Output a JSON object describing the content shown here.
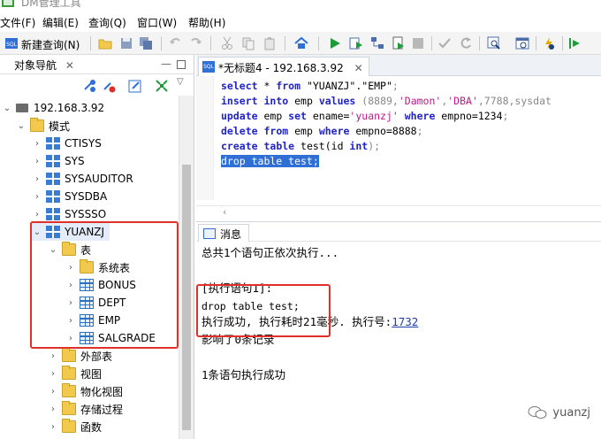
{
  "app": {
    "title": "DM管理工具"
  },
  "menu": [
    {
      "label": "文件(F)"
    },
    {
      "label": "编辑(E)"
    },
    {
      "label": "查询(Q)"
    },
    {
      "label": "窗口(W)"
    },
    {
      "label": "帮助(H)"
    }
  ],
  "toolbar": {
    "new_query_label": "新建查询(N)"
  },
  "navigator": {
    "tab_label": "对象导航",
    "server": "192.168.3.92",
    "schemas_label": "模式",
    "schemas": [
      "CTISYS",
      "SYS",
      "SYSAUDITOR",
      "SYSDBA",
      "SYSSSO",
      "YUANZJ"
    ],
    "tables_label": "表",
    "table_items": [
      "系统表",
      "BONUS",
      "DEPT",
      "EMP",
      "SALGRADE"
    ],
    "other_items": [
      "外部表",
      "视图",
      "物化视图",
      "存储过程",
      "函数"
    ]
  },
  "editor": {
    "tab_label": "*无标题4 - 192.168.3.92",
    "lines": [
      [
        [
          "kw",
          "select"
        ],
        [
          "t",
          " * "
        ],
        [
          "kw",
          "from"
        ],
        [
          "t",
          " \"YUANZJ\".\"EMP\""
        ],
        [
          "tp",
          ";"
        ]
      ],
      [
        [
          "kw",
          "insert"
        ],
        [
          "t",
          " "
        ],
        [
          "kw",
          "into"
        ],
        [
          "t",
          " emp "
        ],
        [
          "kw",
          "values"
        ],
        [
          "t",
          " "
        ],
        [
          "tp",
          "(8889,"
        ],
        [
          "str",
          "'Damon'"
        ],
        [
          "tp",
          ","
        ],
        [
          "str",
          "'DBA'"
        ],
        [
          "tp",
          ",7788,sysdat"
        ]
      ],
      [
        [
          "kw",
          "update"
        ],
        [
          "t",
          " emp "
        ],
        [
          "kw",
          "set"
        ],
        [
          "t",
          " ename="
        ],
        [
          "str",
          "'yuanzj'"
        ],
        [
          "t",
          " "
        ],
        [
          "kw",
          "where"
        ],
        [
          "t",
          " empno=1234"
        ],
        [
          "tp",
          ";"
        ]
      ],
      [
        [
          "kw",
          "delete"
        ],
        [
          "t",
          " "
        ],
        [
          "kw",
          "from"
        ],
        [
          "t",
          " emp "
        ],
        [
          "kw",
          "where"
        ],
        [
          "t",
          " empno=8888"
        ],
        [
          "tp",
          ";"
        ]
      ],
      [
        [
          "kw",
          "create"
        ],
        [
          "t",
          " "
        ],
        [
          "kw",
          "table"
        ],
        [
          "t",
          " test(id "
        ],
        [
          "kw",
          "int"
        ],
        [
          "tp",
          ");"
        ]
      ],
      [
        [
          "sel",
          "drop table test;"
        ]
      ]
    ]
  },
  "messages": {
    "tab_label": "消息",
    "line1": "总共1个语句正依次执行...",
    "line2": "[执行语句1]:",
    "line3": "drop table test;",
    "line4_prefix": "执行成功, 执行耗时21毫秒. 执行号:",
    "line4_link": "1732",
    "line5": "影响了0条记录",
    "line6": "1条语句执行成功"
  },
  "watermark": {
    "text": "yuanzj"
  }
}
